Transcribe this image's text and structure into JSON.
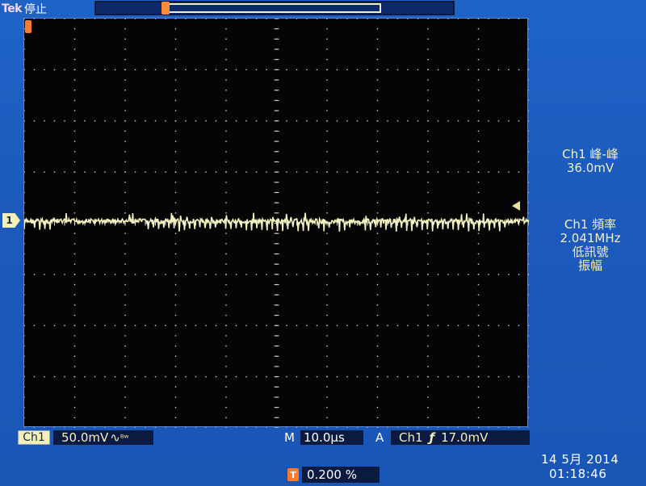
{
  "header": {
    "brand": "Tek",
    "acq_state": "停止"
  },
  "markers": {
    "channel": "1"
  },
  "measurements": {
    "pkpk_label": "Ch1 峰-峰",
    "pkpk_value": "36.0mV",
    "freq_label": "Ch1 頻率",
    "freq_value": "2.041MHz",
    "freq_note1": "低訊號",
    "freq_note2": "振幅"
  },
  "status": {
    "ch_label": "Ch1",
    "vdiv": "50.0mV",
    "coupling_glyph": "∿",
    "bw_glyph": "ᴮʷ",
    "m_label": "M",
    "time_div": "10.0µs",
    "a_label": "A",
    "trig_source": "Ch1",
    "trig_slope": "ƒ",
    "trig_level": "17.0mV",
    "t_icon": "T",
    "trig_pos": "0.200 %"
  },
  "datetime": {
    "date": "14 5月  2014",
    "time": "01:18:46"
  },
  "colors": {
    "background": "#1a5fc4",
    "trace": "#f3f0c0",
    "marker": "#ff7a2a"
  }
}
